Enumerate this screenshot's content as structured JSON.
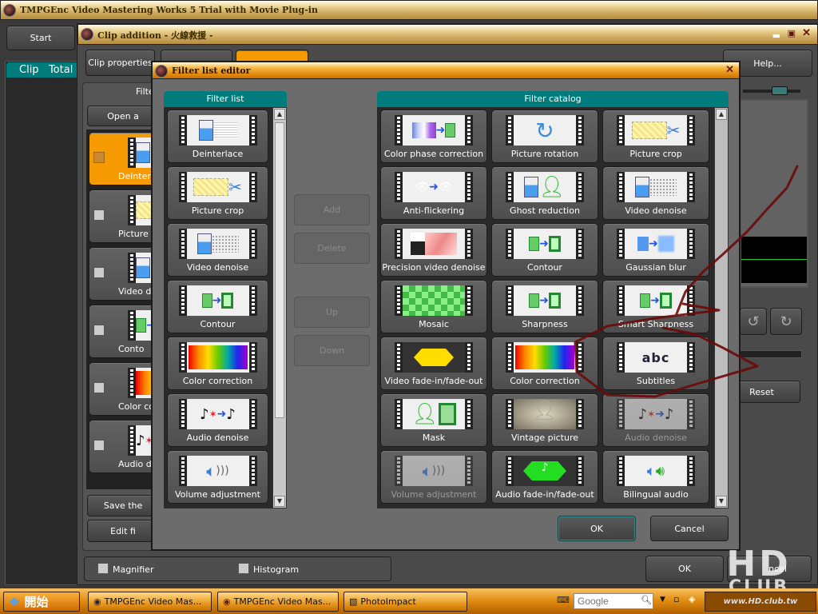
{
  "main_window": {
    "title": "TMPGEnc Video Mastering Works 5 Trial with Movie Plug-in",
    "start_label": "Start",
    "clip_header": "Clip   Total d"
  },
  "clip_addition": {
    "title": "Clip addition - 火線救援 -",
    "tabs": [
      "Clip properties",
      "",
      ""
    ],
    "help_label": "Help...",
    "left_panel": {
      "header": "Filte",
      "open_label": "Open a",
      "items": [
        {
          "label": "Deinter",
          "checked": true,
          "selected": true
        },
        {
          "label": "Picture",
          "checked": false
        },
        {
          "label": "Video de",
          "checked": false
        },
        {
          "label": "Conto",
          "checked": false
        },
        {
          "label": "Color corr",
          "checked": false
        },
        {
          "label": "Audio de",
          "checked": false
        }
      ],
      "save_label": "Save the",
      "edit_label": "Edit fi"
    },
    "reset_label": "Reset",
    "magnifier_label": "Magnifier",
    "histogram_label": "Histogram",
    "ok_label": "OK",
    "cancel_label": "ncel"
  },
  "filter_list_editor": {
    "title": "Filter list editor",
    "filter_list": {
      "header": "Filter list",
      "items": [
        {
          "label": "Deinterlace",
          "icon": "deinterlace"
        },
        {
          "label": "Picture crop",
          "icon": "crop"
        },
        {
          "label": "Video denoise",
          "icon": "denoise"
        },
        {
          "label": "Contour",
          "icon": "contour"
        },
        {
          "label": "Color correction",
          "icon": "color"
        },
        {
          "label": "Audio denoise",
          "icon": "audio-denoise"
        },
        {
          "label": "Volume adjustment",
          "icon": "volume"
        }
      ]
    },
    "buttons": {
      "add": "Add",
      "delete": "Delete",
      "up": "Up",
      "down": "Down"
    },
    "filter_catalog": {
      "header": "Filter catalog",
      "items": [
        {
          "label": "Color phase correction",
          "icon": "color-phase"
        },
        {
          "label": "Picture rotation",
          "icon": "rotation"
        },
        {
          "label": "Picture crop",
          "icon": "crop"
        },
        {
          "label": "Anti-flickering",
          "icon": "anti-flicker"
        },
        {
          "label": "Ghost reduction",
          "icon": "ghost"
        },
        {
          "label": "Video denoise",
          "icon": "denoise"
        },
        {
          "label": "Precision video denoise",
          "icon": "precision-denoise"
        },
        {
          "label": "Contour",
          "icon": "contour"
        },
        {
          "label": "Gaussian blur",
          "icon": "blur"
        },
        {
          "label": "Mosaic",
          "icon": "mosaic"
        },
        {
          "label": "Sharpness",
          "icon": "sharpness"
        },
        {
          "label": "Smart Sharpness",
          "icon": "sharpness"
        },
        {
          "label": "Video fade-in/fade-out",
          "icon": "video-fade"
        },
        {
          "label": "Color correction",
          "icon": "color"
        },
        {
          "label": "Subtitles",
          "icon": "subtitles"
        },
        {
          "label": "Mask",
          "icon": "mask"
        },
        {
          "label": "Vintage picture",
          "icon": "vintage"
        },
        {
          "label": "Audio denoise",
          "icon": "audio-denoise",
          "disabled": true
        },
        {
          "label": "Volume adjustment",
          "icon": "volume",
          "disabled": true
        },
        {
          "label": "Audio fade-in/fade-out",
          "icon": "audio-fade"
        },
        {
          "label": "Bilingual audio",
          "icon": "bilingual"
        }
      ]
    },
    "ok_label": "OK",
    "cancel_label": "Cancel"
  },
  "taskbar": {
    "start_label": "開始",
    "items": [
      "TMPGEnc Video Mas...",
      "TMPGEnc Video Mas...",
      "PhotoImpact"
    ],
    "search_placeholder": "Google"
  },
  "watermark": {
    "text": "HD CLUB",
    "url": "www.HD.club.tw"
  },
  "colors": {
    "accent_teal": "#007c7c",
    "title_orange": "#e08a10",
    "annotation": "#6a0a0a"
  }
}
